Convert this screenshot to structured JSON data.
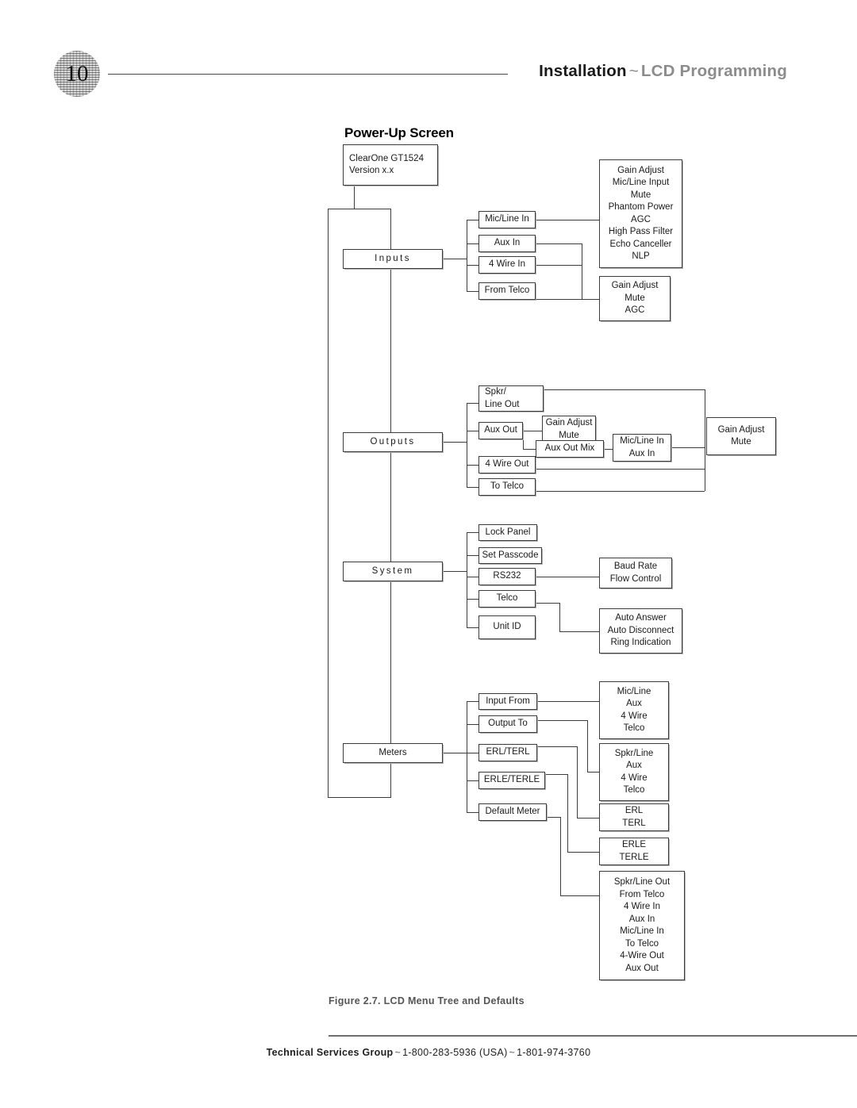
{
  "page": {
    "number": "10"
  },
  "header": {
    "title_dark": "Installation",
    "title_tilde": "~",
    "title_gray": "LCD Programming"
  },
  "figure": {
    "heading": "Power-Up Screen",
    "caption": "Figure 2.7. LCD Menu Tree and Defaults",
    "root": {
      "line1": "ClearOne GT1524",
      "line2": "Version x.x"
    },
    "sections": {
      "inputs": "Inputs",
      "outputs": "Outputs",
      "system": "System",
      "meters": "Meters"
    },
    "inputs": {
      "mic_line_in": "Mic/Line In",
      "aux_in": "Aux In",
      "four_wire_in": "4 Wire In",
      "from_telco": "From Telco",
      "mic_line_params": [
        "Gain Adjust",
        "Mic/Line Input",
        "Mute",
        "Phantom Power",
        "AGC",
        "High Pass Filter",
        "Echo Canceller",
        "NLP"
      ],
      "telco_params": [
        "Gain Adjust",
        "Mute",
        "AGC"
      ]
    },
    "outputs": {
      "spkr_line_out_l1": "Spkr/",
      "spkr_line_out_l2": "Line Out",
      "aux_out": "Aux Out",
      "four_wire_out": "4 Wire Out",
      "to_telco": "To Telco",
      "aux_out_params": [
        "Gain Adjust",
        "Mute"
      ],
      "aux_out_mix": "Aux Out Mix",
      "aux_out_mix_sources": [
        "Mic/Line In",
        "Aux In"
      ],
      "common_params": [
        "Gain Adjust",
        "Mute"
      ]
    },
    "system": {
      "lock_panel": "Lock Panel",
      "set_passcode": "Set Passcode",
      "rs232": "RS232",
      "telco": "Telco",
      "unit_id": "Unit ID",
      "rs232_params": [
        "Baud Rate",
        "Flow Control"
      ],
      "telco_params": [
        "Auto Answer",
        "Auto Disconnect",
        "Ring Indication"
      ]
    },
    "meters": {
      "input_from": "Input From",
      "output_to": "Output To",
      "erl_terl": "ERL/TERL",
      "erle_terle": "ERLE/TERLE",
      "default_meter": "Default Meter",
      "input_sources": [
        "Mic/Line",
        "Aux",
        "4 Wire",
        "Telco"
      ],
      "output_sources": [
        "Spkr/Line",
        "Aux",
        "4 Wire",
        "Telco"
      ],
      "erl_values": [
        "ERL",
        "TERL"
      ],
      "erle_values": [
        "ERLE",
        "TERLE"
      ],
      "default_meter_values": [
        "Spkr/Line Out",
        "From Telco",
        "4 Wire In",
        "Aux In",
        "Mic/Line In",
        "To Telco",
        "4-Wire Out",
        "Aux Out"
      ]
    }
  },
  "footer": {
    "label": "Technical Services Group",
    "tilde1": "~",
    "phone_usa": "1-800-283-5936 (USA)",
    "tilde2": "~",
    "phone_intl": "1-801-974-3760"
  }
}
